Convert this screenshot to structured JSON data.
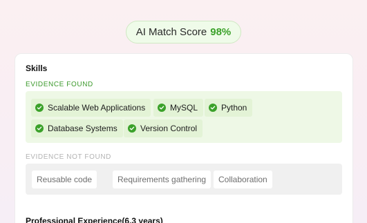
{
  "score": {
    "label": "AI Match Score",
    "value": "98%"
  },
  "skills": {
    "title": "Skills",
    "found_label": "EVIDENCE FOUND",
    "found": [
      "Scalable Web Applications",
      "MySQL",
      "Python",
      "Database Systems",
      "Version Control"
    ],
    "not_found_label": "EVIDENCE NOT FOUND",
    "not_found": [
      "Reusable code",
      "Requirements gathering",
      "Collaboration"
    ]
  },
  "experience": {
    "title": "Professional Experience(6.3 years)"
  },
  "colors": {
    "accent_green": "#3ba12a",
    "found_bg": "#eef8e6",
    "notfound_bg": "#f0f0f0"
  },
  "icons": {
    "found_chip": "check-circle-icon"
  }
}
